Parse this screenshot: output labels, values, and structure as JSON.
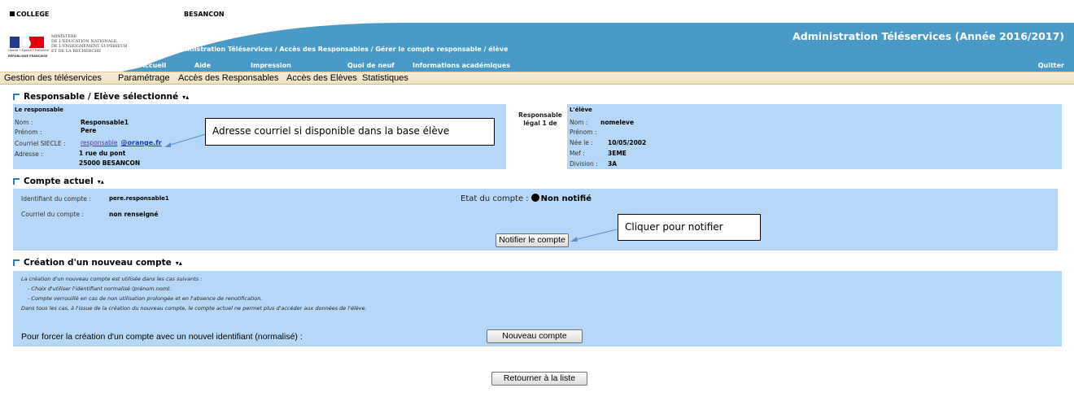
{
  "header": {
    "college_label": "COLLEGE",
    "city": "BESANCON",
    "ministry_lines": [
      "MINISTÈRE",
      "DE L'ÉDUCATION NATIONALE,",
      "DE L'ENSEIGNEMENT SUPÉRIEUR",
      "ET DE LA RECHERCHE"
    ],
    "logo_caption": "Liberté • Égalité • Fraternité",
    "logo_country": "RÉPUBLIQUE FRANÇAISE",
    "breadcrumb": "Administration Téléservices / Accès des Responsables / Gérer le compte responsable / élève",
    "app_title": "Administration Téléservices (Année 2016/2017)",
    "nav": [
      "Accueil",
      "Aide",
      "Impression",
      "Quoi de neuf",
      "Informations académiques"
    ],
    "quit_label": "Quitter",
    "banner_color": "#4a9ac8"
  },
  "menu": [
    "Gestion des téléservices",
    "Paramétrage",
    "Accès des Responsables",
    "Accès des Elèves",
    "Statistiques"
  ],
  "selected": {
    "title": "Responsable / Elève sélectionné",
    "responsable": {
      "heading": "Le responsable",
      "nom_label": "Nom :",
      "nom": "Responsable1",
      "prenom_label": "Prénom :",
      "prenom": "Pere",
      "courriel_label": "Courriel SIECLE :",
      "courriel_part1": "responsable",
      "courriel_part2": "@orange.fr",
      "adresse_label": "Adresse :",
      "adresse_line1": "1 rue du pont",
      "adresse_line2": "25000 BESANCON"
    },
    "relation_line1": "Responsable",
    "relation_line2": "légal 1 de",
    "eleve": {
      "heading": "L'élève",
      "nom_label": "Nom :",
      "nom": "nomeleve",
      "prenom_label": "Prénom :",
      "prenom": "",
      "naissance_label": "Née le :",
      "naissance": "10/05/2002",
      "mef_label": "Mef :",
      "mef": "3EME",
      "division_label": "Division :",
      "division": "3A"
    },
    "callout": "Adresse courriel si disponible dans la base élève"
  },
  "account": {
    "title": "Compte actuel",
    "identifiant_label": "Identifiant du compte :",
    "identifiant": "pere.responsable1",
    "courriel_label": "Courriel du compte :",
    "courriel": "non renseigné",
    "etat_label": "Etat du compte :",
    "etat": "Non notifié",
    "notify_button": "Notifier le compte",
    "callout": "Cliquer pour notifier"
  },
  "new_account": {
    "title": "Création d'un nouveau compte",
    "lines": [
      "La création d'un nouveau compte est utilisée dans les cas suivants :",
      "- Choix d'utiliser l'identifiant normalisé (prénom.nom).",
      "- Compte verrouillé en cas de non utilisation prolongée et en l'absence de renotification.",
      "Dans tous les cas, à l'issue de la création du nouveau compte, le compte actuel ne permet plus d'accéder aux données de l'élève."
    ],
    "force_label": "Pour forcer la création d'un compte avec un nouvel identifiant (normalisé) :",
    "new_button": "Nouveau compte"
  },
  "back_button": "Retourner à la liste",
  "colors": {
    "panel": "#b5d8f8",
    "banner": "#4a9ac8",
    "menubar": "#f3e6cb",
    "link": "#1a3cc0"
  }
}
